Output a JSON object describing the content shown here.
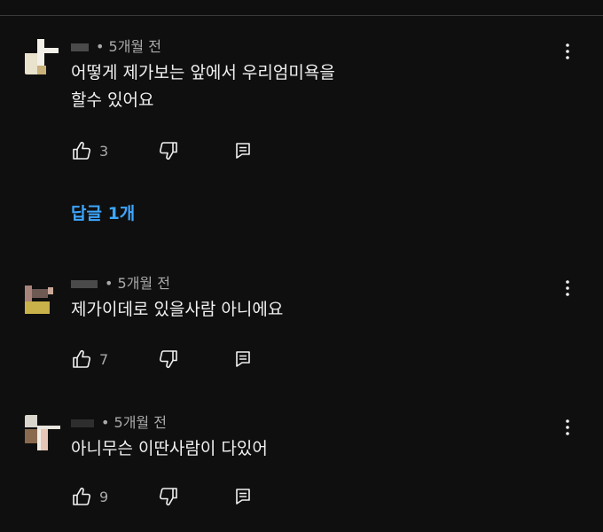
{
  "comments": [
    {
      "time_ago": "• 5개월 전",
      "text": "어떻게 제가보는 앞에서 우리엄미욕을\n할수 있어요",
      "like_count": "3"
    },
    {
      "time_ago": "• 5개월 전",
      "text": "제가이데로 있을사람 아니에요",
      "like_count": "7"
    },
    {
      "time_ago": "• 5개월 전",
      "text": "아니무슨 이딴사람이 다있어",
      "like_count": "9"
    }
  ],
  "replies_toggle": "답글 1개",
  "colors": {
    "background": "#0f0f0f",
    "text_primary": "#f1f1f1",
    "text_secondary": "#aaaaaa",
    "link": "#3ea6ff"
  },
  "icons": [
    "like-icon",
    "dislike-icon",
    "reply-icon",
    "more-vert-icon"
  ]
}
